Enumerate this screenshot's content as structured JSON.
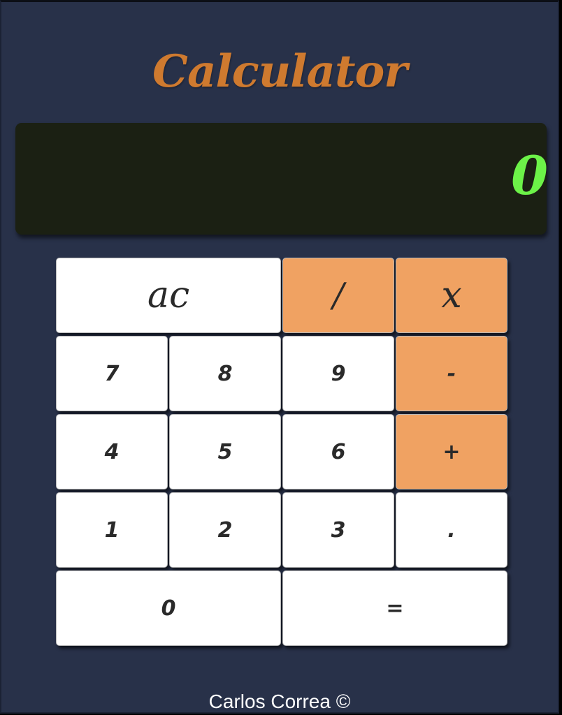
{
  "app": {
    "title": "Calculator",
    "footer": "Carlos Correa ©"
  },
  "display": {
    "value": "0"
  },
  "keys": {
    "clear": "ac",
    "divide": "/",
    "multiply": "x",
    "seven": "7",
    "eight": "8",
    "nine": "9",
    "subtract": "-",
    "four": "4",
    "five": "5",
    "six": "6",
    "add": "+",
    "one": "1",
    "two": "2",
    "three": "3",
    "decimal": ".",
    "zero": "0",
    "equals": "="
  },
  "colors": {
    "background": "#283149",
    "title": "#cf7a2f",
    "display_bg": "#1b2013",
    "display_text": "#6cf248",
    "operator_key": "#f0a262",
    "number_key": "#ffffff"
  }
}
